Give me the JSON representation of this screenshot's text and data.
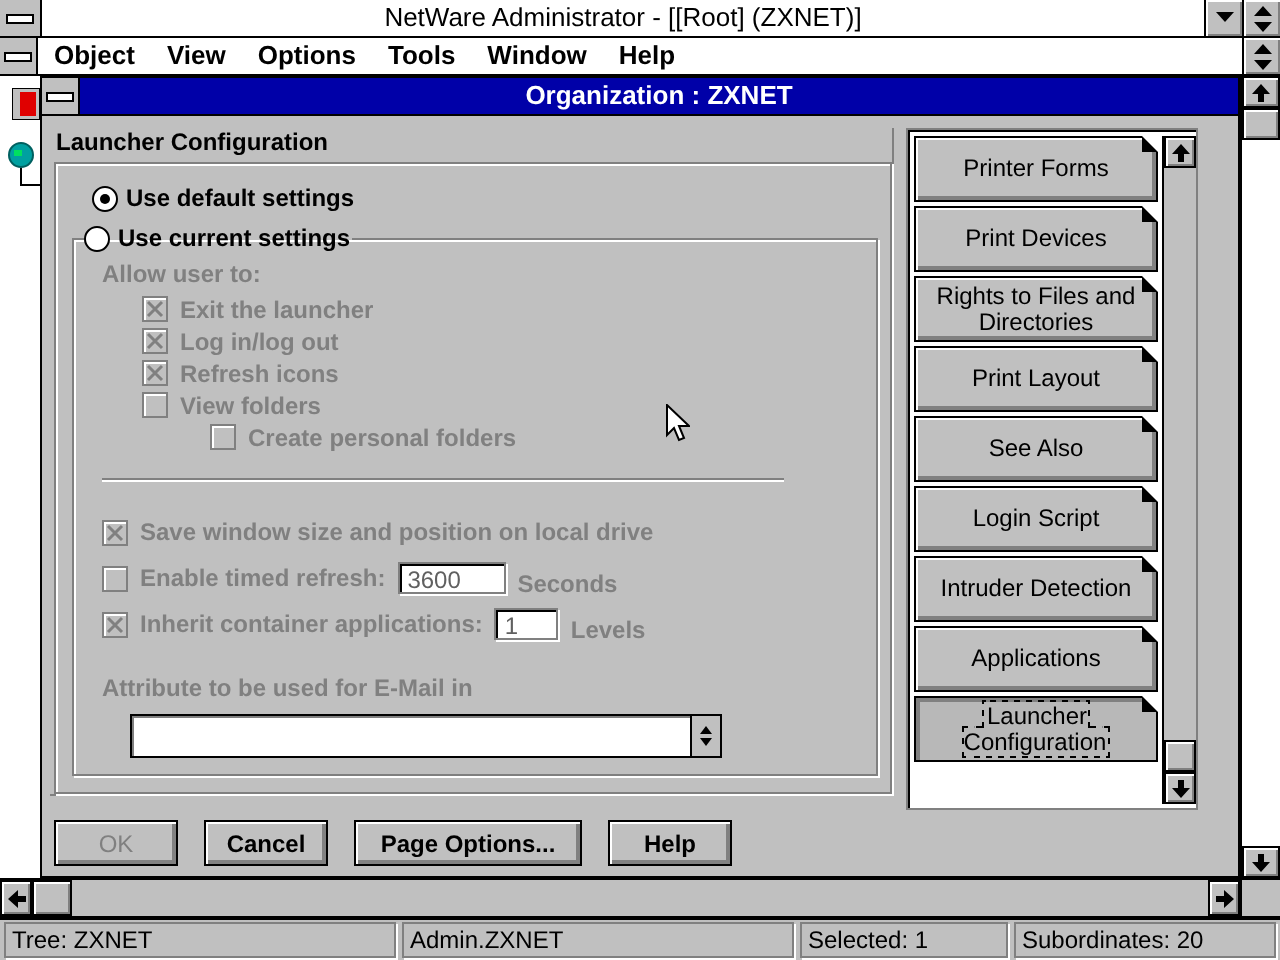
{
  "app_window": {
    "title": "NetWare Administrator - [[Root] (ZXNET)]"
  },
  "menu": [
    "Object",
    "View",
    "Options",
    "Tools",
    "Window",
    "Help"
  ],
  "child_window": {
    "title": "Organization : ZXNET"
  },
  "page": {
    "title": "Launcher Configuration",
    "radios": [
      {
        "label": "Use default settings",
        "selected": true
      },
      {
        "label": "Use current settings",
        "selected": false
      }
    ],
    "allow_label": "Allow user to:",
    "allow_options": [
      {
        "label": "Exit the launcher",
        "checked": true,
        "disabled": true
      },
      {
        "label": "Log in/log out",
        "checked": true,
        "disabled": true
      },
      {
        "label": "Refresh icons",
        "checked": true,
        "disabled": true
      },
      {
        "label": "View folders",
        "checked": false,
        "disabled": true,
        "children": [
          {
            "label": "Create personal folders",
            "checked": false,
            "disabled": true
          }
        ]
      }
    ],
    "settings": [
      {
        "kind": "checkbox",
        "label": "Save window size and position on local drive",
        "checked": true,
        "disabled": true
      },
      {
        "kind": "number",
        "label": "Enable timed refresh:",
        "checked": false,
        "disabled": true,
        "value": "3600",
        "unit": "Seconds"
      },
      {
        "kind": "number",
        "label": "Inherit container applications:",
        "checked": true,
        "disabled": true,
        "value": "1",
        "unit": "Levels"
      }
    ],
    "email_label": "Attribute to be used for E-Mail in"
  },
  "tabs": [
    {
      "label": "Printer Forms",
      "selected": false
    },
    {
      "label": "Print Devices",
      "selected": false
    },
    {
      "label": "Rights to Files and Directories",
      "selected": false
    },
    {
      "label": "Print Layout",
      "selected": false
    },
    {
      "label": "See Also",
      "selected": false
    },
    {
      "label": "Login Script",
      "selected": false
    },
    {
      "label": "Intruder Detection",
      "selected": false
    },
    {
      "label": "Applications",
      "selected": false
    },
    {
      "label": "Launcher Configuration",
      "selected": true
    }
  ],
  "buttons": [
    {
      "label": "OK",
      "disabled": true
    },
    {
      "label": "Cancel",
      "disabled": false
    },
    {
      "label": "Page Options...",
      "disabled": false
    },
    {
      "label": "Help",
      "disabled": false
    }
  ],
  "status_bar": [
    "Tree: ZXNET",
    "Admin.ZXNET",
    "Selected: 1",
    "Subordinates: 20"
  ]
}
